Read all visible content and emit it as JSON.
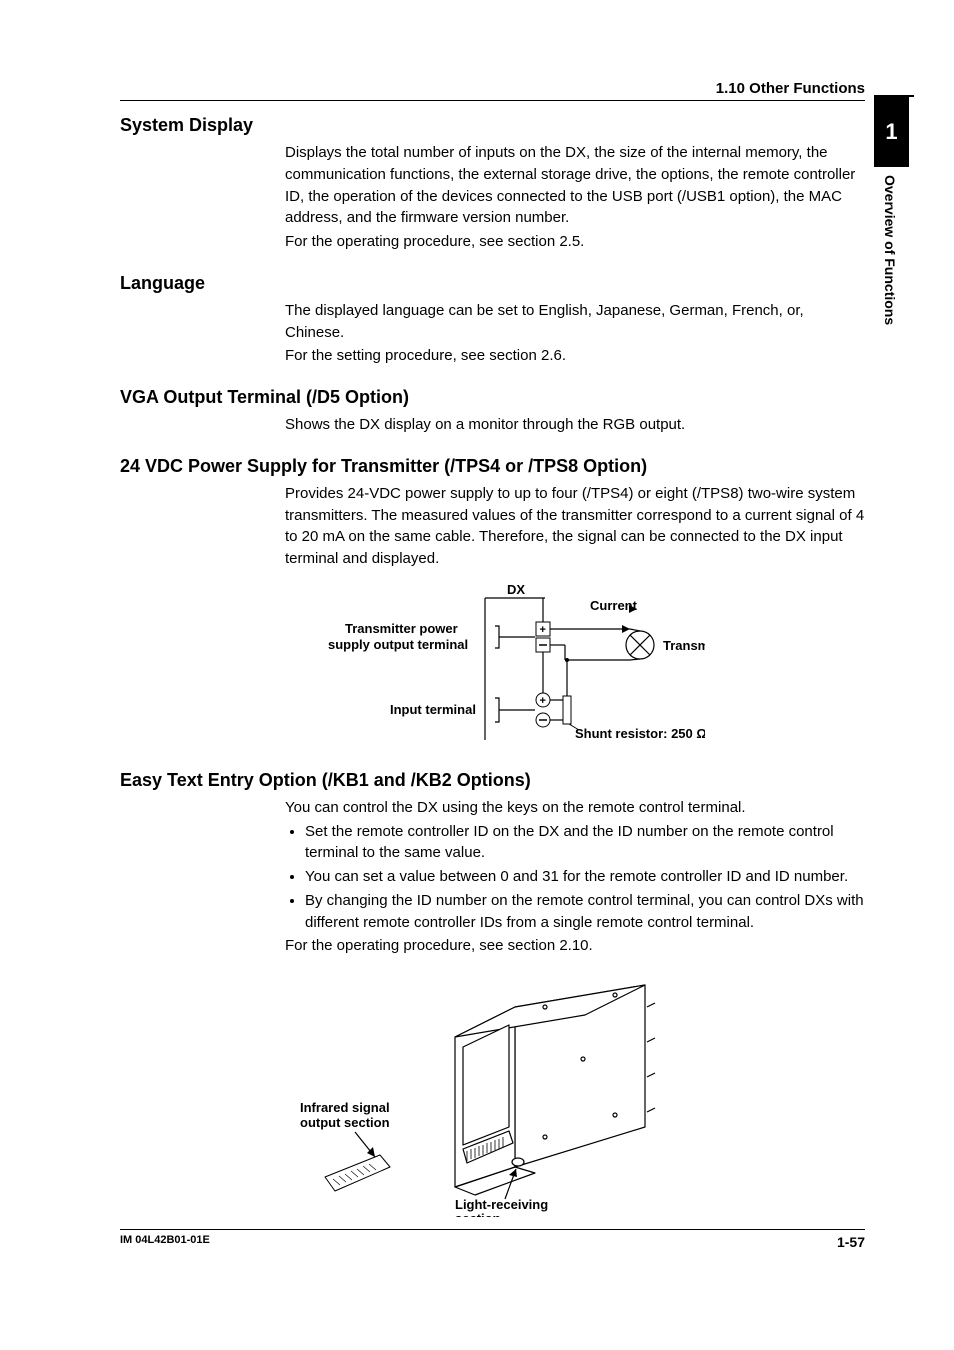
{
  "header": {
    "subtitle": "1.10  Other Functions"
  },
  "sidetab": {
    "chapter": "1",
    "label": "Overview of Functions"
  },
  "sections": {
    "system_display": {
      "heading": "System Display",
      "body": "Displays the total number of inputs on the DX, the size of the internal memory, the communication functions, the external storage drive, the options, the remote controller ID, the operation of the devices connected to the USB port (/USB1 option), the MAC address, and the firmware version number.",
      "ref": "For the operating procedure, see section 2.5."
    },
    "language": {
      "heading": "Language",
      "body": "The displayed language can be set to English, Japanese, German, French, or, Chinese.",
      "ref": "For the setting procedure, see section 2.6."
    },
    "vga": {
      "heading": "VGA Output Terminal (/D5 Option)",
      "body": "Shows the DX display on a monitor through the RGB output."
    },
    "ps24": {
      "heading": "24 VDC Power Supply for Transmitter (/TPS4 or /TPS8 Option)",
      "body": "Provides 24-VDC power supply to up to four (/TPS4) or eight (/TPS8) two-wire system transmitters. The measured values of the transmitter correspond to a current signal of 4 to 20 mA on the same cable. Therefore, the signal can be connected to the DX input terminal and displayed."
    },
    "easytext": {
      "heading": "Easy Text Entry Option (/KB1 and /KB2 Options)",
      "intro": "You can control the DX using the keys on the remote control terminal.",
      "bullets": [
        "Set the remote controller ID on the DX and the ID number on the remote control terminal to the same value.",
        "You can set a value between 0 and 31 for the remote controller ID and ID number.",
        "By changing the ID number on the remote control terminal, you can control DXs with different remote controller IDs from a single remote control terminal."
      ],
      "ref": "For the operating procedure, see section 2.10."
    }
  },
  "diagram1": {
    "dx": "DX",
    "current": "Current",
    "tps1": "Transmitter power",
    "tps2": "supply output terminal",
    "transmitter": "Transmitter",
    "input": "Input terminal",
    "shunt": "Shunt resistor: 250 Ω",
    "plus": "+",
    "minus": "−"
  },
  "diagram2": {
    "ir1": "Infrared signal",
    "ir2": "output section",
    "lr1": "Light-receiving",
    "lr2": "section"
  },
  "footer": {
    "doc": "IM 04L42B01-01E",
    "page": "1-57"
  }
}
